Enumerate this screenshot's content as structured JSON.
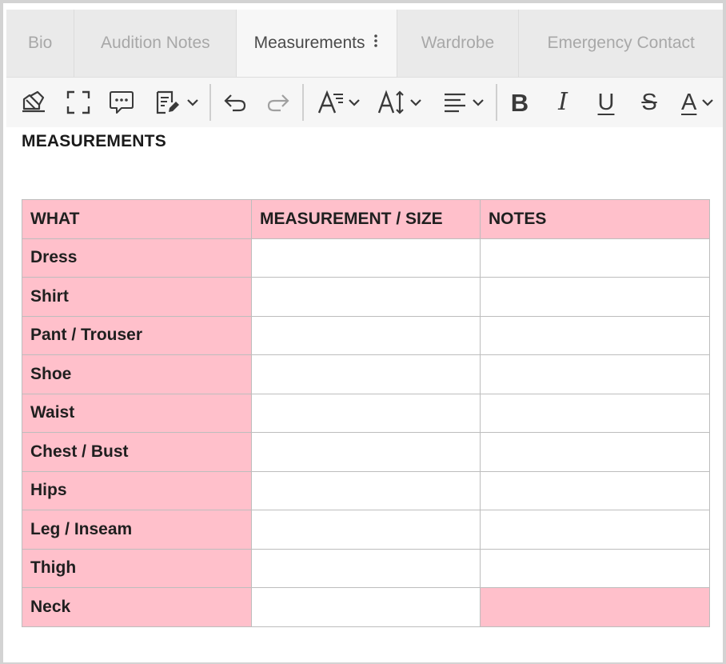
{
  "tabs": [
    {
      "label": "Bio",
      "active": false
    },
    {
      "label": "Audition Notes",
      "active": false
    },
    {
      "label": "Measurements",
      "active": true
    },
    {
      "label": "Wardrobe",
      "active": false
    },
    {
      "label": "Emergency Contact",
      "active": false
    }
  ],
  "toolbar": {
    "icons": [
      "clear-format-icon",
      "fullscreen-icon",
      "comment-icon",
      "note-edit-icon",
      "undo-icon",
      "redo-icon",
      "font-size-icon",
      "line-height-icon",
      "align-icon",
      "bold-icon",
      "italic-icon",
      "underline-icon",
      "strikethrough-icon",
      "font-color-icon"
    ],
    "bold_glyph": "B",
    "italic_glyph": "I",
    "underline_glyph": "U",
    "strike_glyph": "S",
    "color_glyph": "A"
  },
  "colors": {
    "header_fill": "#ffc0cb",
    "tab_active_text": "#4a4a4a",
    "tab_inactive_text": "#a8a8a8"
  },
  "document": {
    "heading": "MEASUREMENTS",
    "table": {
      "headers": [
        "WHAT",
        "MEASUREMENT / SIZE",
        "NOTES"
      ],
      "rows": [
        {
          "what": "Dress",
          "size": "",
          "notes": ""
        },
        {
          "what": "Shirt",
          "size": "",
          "notes": ""
        },
        {
          "what": "Pant / Trouser",
          "size": "",
          "notes": ""
        },
        {
          "what": "Shoe",
          "size": "",
          "notes": ""
        },
        {
          "what": "Waist",
          "size": "",
          "notes": ""
        },
        {
          "what": "Chest / Bust",
          "size": "",
          "notes": ""
        },
        {
          "what": "Hips",
          "size": "",
          "notes": ""
        },
        {
          "what": "Leg / Inseam",
          "size": "",
          "notes": ""
        },
        {
          "what": "Thigh",
          "size": "",
          "notes": ""
        },
        {
          "what": "Neck",
          "size": "",
          "notes": ""
        }
      ]
    }
  }
}
